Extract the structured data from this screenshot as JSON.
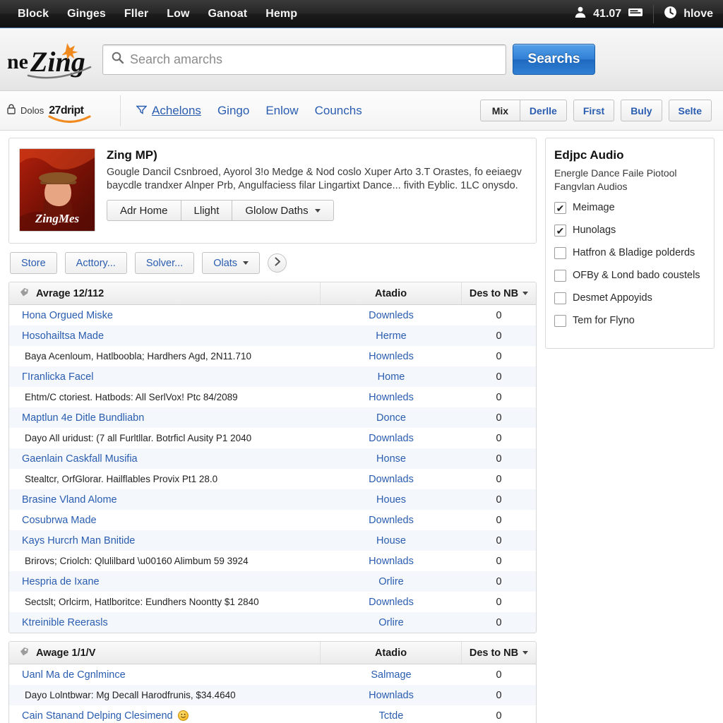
{
  "topbar": {
    "nav": [
      "Block",
      "Ginges",
      "Fller",
      "Low",
      "Ganoat",
      "Hemp"
    ],
    "account_value": "41.07",
    "user_label": "hlove",
    "icons": {
      "person": "person-icon",
      "cart": "cart-icon",
      "clock": "clock-icon"
    }
  },
  "header": {
    "logo_text": "neZing",
    "search_placeholder": "Search amarchs",
    "search_value": "",
    "search_button": "Searchs"
  },
  "subnav": {
    "lock_label": "Dolos",
    "brand": "27dript",
    "links": [
      {
        "label": "Achelons",
        "active": true
      },
      {
        "label": "Gingo",
        "active": false
      },
      {
        "label": "Enlow",
        "active": false
      },
      {
        "label": "Counchs",
        "active": false
      }
    ],
    "group_buttons": [
      "Mix",
      "Derlle"
    ],
    "buttons": [
      "First",
      "Buly",
      "Selte"
    ]
  },
  "product": {
    "title": "Zing MP)",
    "description": "Gougle Dancil Csnbroed, Ayorol 3!o Medge & Nod coslo Xuper Arto 3.T Orastes, fo eeiaegv baycdle trandxer Alnper Prb, Angulfaciess filar Lingartixt Dance... fivith Eyblic. 1LC onysdo.",
    "buttons": [
      "Adr Home",
      "Llight",
      "Glolow Daths"
    ],
    "thumb_caption": "ZingMes"
  },
  "toolbar": {
    "buttons": [
      "Store",
      "Acttory...",
      "Solver..."
    ],
    "dropdown": "Olats",
    "next_icon": "chevron-right-icon"
  },
  "tables": [
    {
      "headers": {
        "col1": "Avrage 12/112",
        "col2": "Atadio",
        "col3": "Des to NB"
      },
      "rows": [
        {
          "name": "Hona Orgued Miske",
          "type": "Downleds",
          "count": "0",
          "sub": false
        },
        {
          "name": "Hosohailtsa Made",
          "type": "Herme",
          "count": "0",
          "sub": false
        },
        {
          "name": "Baya Acenloum, Hatlboobla; Hardhers Agd, 2N11.710",
          "type": "Hownleds",
          "count": "0",
          "sub": true
        },
        {
          "name": "ΓIranlicka Facel",
          "type": "Home",
          "count": "0",
          "sub": false
        },
        {
          "name": "Ehtm/C ctoriest. Hatbods: All SerlVox! Ptc 84/2089",
          "type": "Hownleds",
          "count": "0",
          "sub": true
        },
        {
          "name": "Maptlun 4e Ditle Bundliabn",
          "type": "Donce",
          "count": "0",
          "sub": false
        },
        {
          "name": "Dayo All uridust: (7 all Furltllar. Botrficl Ausity P1 2040",
          "type": "Downlads",
          "count": "0",
          "sub": true
        },
        {
          "name": "Gaenlain Caskfall Musifia",
          "type": "Honse",
          "count": "0",
          "sub": false
        },
        {
          "name": "Stealtcr, OrfGlorar. Hailflables Provix Pt1 28.0",
          "type": "Downlads",
          "count": "0",
          "sub": true
        },
        {
          "name": "Brasine Vland Alome",
          "type": "Houes",
          "count": "0",
          "sub": false
        },
        {
          "name": "Cosubrwa Made",
          "type": "Downleds",
          "count": "0",
          "sub": false
        },
        {
          "name": "Kays Hurcrh Man Bnitide",
          "type": "House",
          "count": "0",
          "sub": false
        },
        {
          "name": "Brirovs; Criolch: Qlulilbard \\u00160 Alimbum 59 3924",
          "type": "Hownlads",
          "count": "0",
          "sub": true
        },
        {
          "name": "Hespria de Ixane",
          "type": "Orlire",
          "count": "0",
          "sub": false
        },
        {
          "name": "Sectslt; Orlcirm, Hatlboritce: Eundhers Noontty $1 2840",
          "type": "Downleds",
          "count": "0",
          "sub": true
        },
        {
          "name": "Ktreinible Reerasls",
          "type": "Orlire",
          "count": "0",
          "sub": false
        }
      ]
    },
    {
      "headers": {
        "col1": "Awage 1/1/V",
        "col2": "Atadio",
        "col3": "Des to NB"
      },
      "rows": [
        {
          "name": "Uanl Ma de Cgnlmince",
          "type": "Salmage",
          "count": "0",
          "sub": false
        },
        {
          "name": "Dayo Lolntbwar: Mɡ Decall Harodfrunis, $34.4640",
          "type": "Hownlads",
          "count": "0",
          "sub": true
        },
        {
          "name": "Cain Stanand Delping Clesimend",
          "type": "Tctde",
          "count": "0",
          "sub": false,
          "emoji": "🙂"
        }
      ]
    }
  ],
  "sidebar": {
    "title": "Edjpc Audio",
    "subtitle": "Energle Dance Faile Piotool Fangvlan Audios",
    "options": [
      {
        "label": "Meimage",
        "checked": true
      },
      {
        "label": "Hunolags",
        "checked": true
      },
      {
        "label": "Hatfron & Bladige polderds",
        "checked": false
      },
      {
        "label": "OFBy & Lond bado coustels",
        "checked": false
      },
      {
        "label": "Desmet Appoyids",
        "checked": false
      },
      {
        "label": "Tem for Flyno",
        "checked": false
      }
    ]
  },
  "colors": {
    "link": "#2a5db0",
    "accent_blue": "#2f7fd4",
    "topbar_bg": "#1c1c1c",
    "alt_row": "#f4f7fb",
    "brand_orange": "#f08a1e"
  }
}
